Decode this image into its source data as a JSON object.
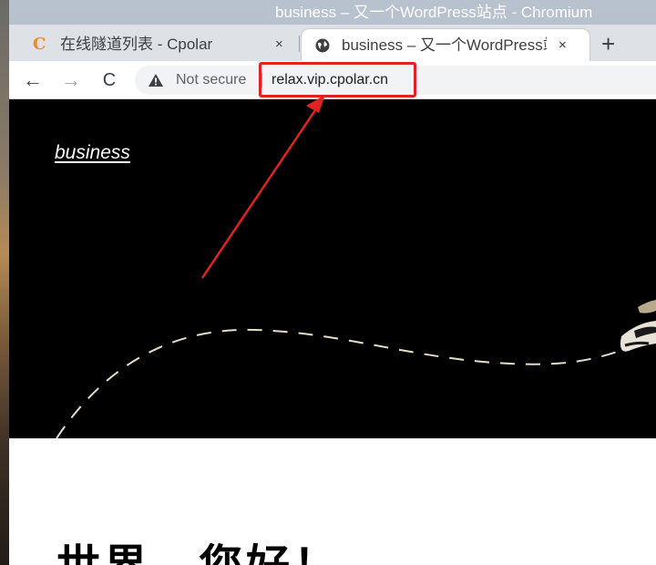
{
  "window": {
    "title": "business – 又一个WordPress站点 - Chromium"
  },
  "tabs": [
    {
      "title": "在线隧道列表 - Cpolar",
      "favicon": "cpolar-c-icon",
      "close_label": "×"
    },
    {
      "title": "business – 又一个WordPress站点",
      "favicon": "globe-icon",
      "close_label": "×"
    }
  ],
  "new_tab_label": "+",
  "toolbar": {
    "back_label": "←",
    "forward_label": "→",
    "reload_label": "C",
    "security_label": "Not secure",
    "url": "relax.vip.cpolar.cn"
  },
  "page": {
    "site_title": "business",
    "post_title": "世界，您好！"
  },
  "colors": {
    "annotation": "#e02222",
    "titlebar": "#b8c1ce",
    "hero_background": "#000000"
  }
}
